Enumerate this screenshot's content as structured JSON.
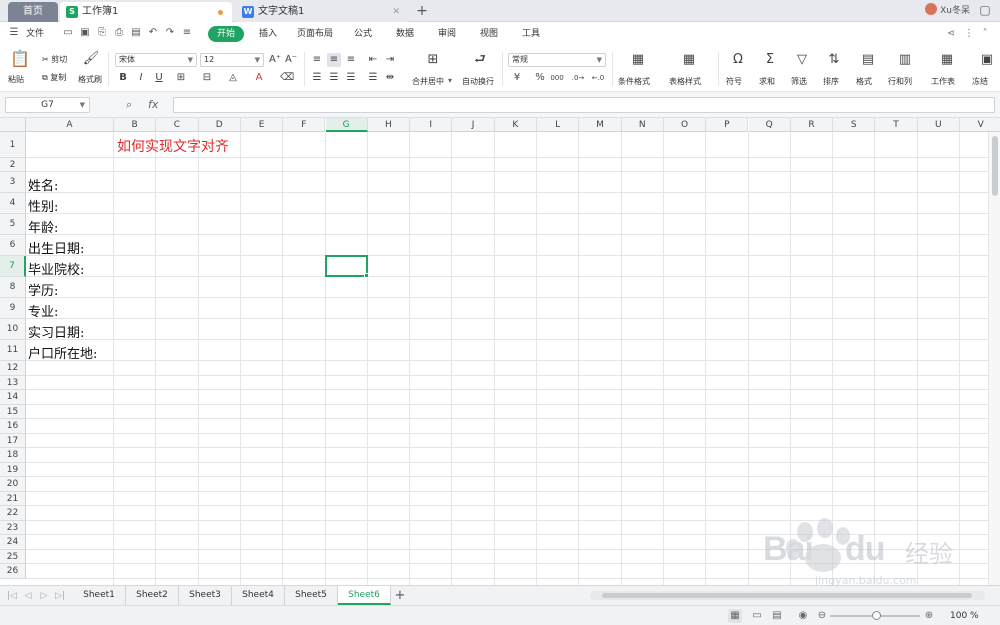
{
  "tabs": {
    "home": "首页",
    "workbook": "工作簿1",
    "workbook_icon": "S",
    "document": "文字文稿1",
    "document_icon": "W",
    "user": "Xu冬呆"
  },
  "menu": {
    "file": "文件",
    "start": "开始",
    "items": [
      "插入",
      "页面布局",
      "公式",
      "数据",
      "审阅",
      "视图",
      "工具"
    ]
  },
  "ribbon": {
    "paste": "粘贴",
    "cut": "剪切",
    "copy": "复制",
    "format_painter": "格式刷",
    "font": "宋体",
    "font_size": "12",
    "merge_center": "合并居中",
    "wrap_text": "自动换行",
    "number_format": "常规",
    "conditional_format": "条件格式",
    "table_style": "表格样式",
    "symbol": "符号",
    "sum": "求和",
    "filter": "筛选",
    "sort": "排序",
    "format": "格式",
    "row_col": "行和列",
    "worksheet": "工作表",
    "freeze": "冻结"
  },
  "formula_bar": {
    "name_box": "G7",
    "fx": "fx",
    "content": ""
  },
  "grid": {
    "columns": [
      "A",
      "B",
      "C",
      "D",
      "E",
      "F",
      "G",
      "H",
      "I",
      "J",
      "K",
      "L",
      "M",
      "N",
      "O",
      "P",
      "Q",
      "R",
      "S",
      "T",
      "U",
      "V"
    ],
    "rows": [
      "1",
      "2",
      "3",
      "4",
      "5",
      "6",
      "7",
      "8",
      "9",
      "10",
      "11",
      "12",
      "13",
      "14",
      "15",
      "16",
      "17",
      "18",
      "19",
      "20",
      "21",
      "22",
      "23",
      "24",
      "25",
      "26"
    ],
    "selected_column": "G",
    "selected_row": "7",
    "title_cell": "如何实现文字对齐",
    "title_color": "#e02b2b",
    "labels": [
      "姓名:",
      "性别:",
      "年龄:",
      "出生日期:",
      "毕业院校:",
      "学历:",
      "专业:",
      "实习日期:",
      "户口所在地:"
    ]
  },
  "sheets": {
    "names": [
      "Sheet1",
      "Sheet2",
      "Sheet3",
      "Sheet4",
      "Sheet5",
      "Sheet6"
    ],
    "active": "Sheet6"
  },
  "status": {
    "zoom": "100 %"
  },
  "watermark": {
    "brand": "Bai",
    "brand2": "du",
    "cn": "经验",
    "url": "jingyan.baidu.com"
  },
  "colors": {
    "accent": "#1fa463",
    "home_tab": "#7b8394"
  }
}
